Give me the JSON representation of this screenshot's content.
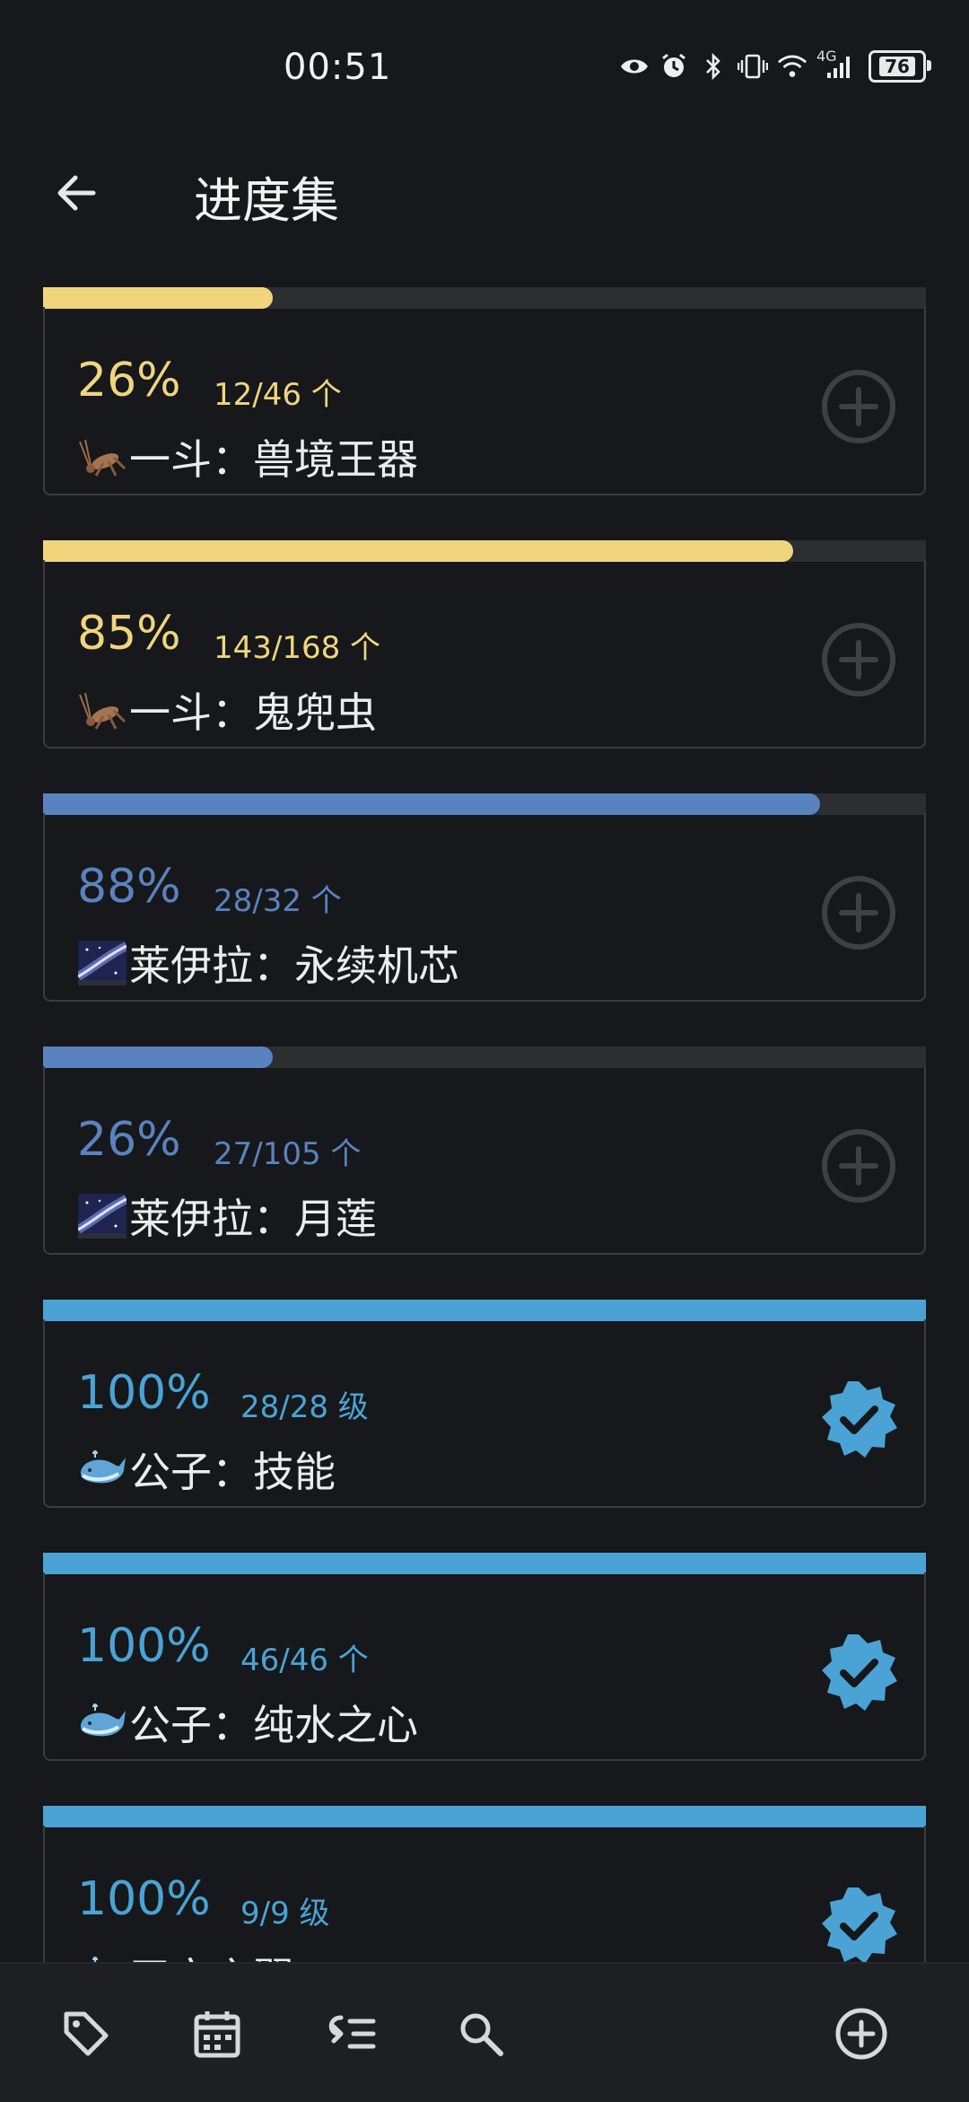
{
  "status_bar": {
    "time": "00:51",
    "battery": "76",
    "network": "4G"
  },
  "header": {
    "title": "进度集"
  },
  "colors": {
    "yellow": "#f0d57d",
    "blue": "#5a82bf",
    "cyan": "#4aa3d4",
    "track": "#2c2e32"
  },
  "items": [
    {
      "progress": 0.26,
      "percent": "26%",
      "count": "12/46 个",
      "name": "一斗：兽境王器",
      "icon": "cricket-icon",
      "color": "yellow",
      "action": "add-circle-icon"
    },
    {
      "progress": 0.85,
      "percent": "85%",
      "count": "143/168 个",
      "name": "一斗：鬼兜虫",
      "icon": "cricket-icon",
      "color": "yellow",
      "action": "add-circle-icon"
    },
    {
      "progress": 0.88,
      "percent": "88%",
      "count": "28/32 个",
      "name": "莱伊拉：永续机芯",
      "icon": "milky-way-icon",
      "color": "blue",
      "action": "add-circle-icon"
    },
    {
      "progress": 0.26,
      "percent": "26%",
      "count": "27/105 个",
      "name": "莱伊拉：月莲",
      "icon": "milky-way-icon",
      "color": "blue",
      "action": "add-circle-icon"
    },
    {
      "progress": 1.0,
      "percent": "100%",
      "count": "28/28 级",
      "name": "公子：技能",
      "icon": "whale-icon",
      "color": "cyan",
      "action": "verified-check-icon"
    },
    {
      "progress": 1.0,
      "percent": "100%",
      "count": "46/46 个",
      "name": "公子：纯水之心",
      "icon": "whale-icon",
      "color": "cyan",
      "action": "verified-check-icon"
    },
    {
      "progress": 1.0,
      "percent": "100%",
      "count": "9/9 级",
      "name": "天空之翼",
      "icon": "whale-icon",
      "color": "cyan",
      "action": "verified-check-icon"
    }
  ],
  "bottom_nav": [
    "tag-icon",
    "calendar-icon",
    "list-sort-icon",
    "search-icon",
    "add-circle-icon"
  ]
}
